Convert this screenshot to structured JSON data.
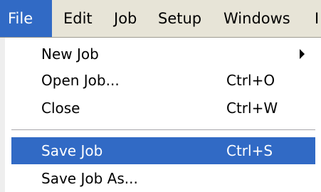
{
  "menubar": {
    "items": [
      {
        "label": "File",
        "active": true
      },
      {
        "label": "Edit"
      },
      {
        "label": "Job"
      },
      {
        "label": "Setup"
      },
      {
        "label": "Windows"
      },
      {
        "label": "I"
      }
    ]
  },
  "file_menu": {
    "items": [
      {
        "label": "New Job",
        "shortcut": "",
        "submenu": true
      },
      {
        "label": "Open Job...",
        "shortcut": "Ctrl+O"
      },
      {
        "label": "Close",
        "shortcut": "Ctrl+W"
      },
      {
        "label": "Save Job",
        "shortcut": "Ctrl+S",
        "highlighted": true
      },
      {
        "label": "Save Job As...",
        "shortcut": ""
      }
    ]
  },
  "colors": {
    "menubar_bg": "#e7e4d7",
    "highlight": "#316ac5",
    "highlight_text": "#ffffff"
  },
  "icons": {
    "submenu": "chevron-right-icon"
  }
}
